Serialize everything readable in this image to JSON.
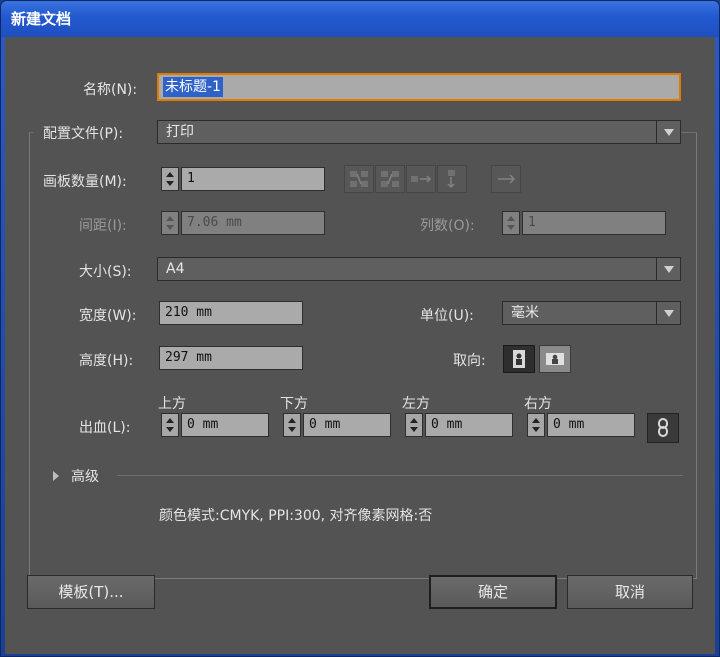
{
  "window": {
    "title": "新建文档"
  },
  "name": {
    "label": "名称(N):",
    "value": "未标题-1"
  },
  "profile": {
    "label": "配置文件(P):",
    "value": "打印"
  },
  "artboards": {
    "count_label": "画板数量(M):",
    "count_value": "1",
    "spacing_label": "间距(I):",
    "spacing_value": "7.06 mm",
    "columns_label": "列数(O):",
    "columns_value": "1"
  },
  "size": {
    "label": "大小(S):",
    "value": "A4"
  },
  "width": {
    "label": "宽度(W):",
    "value": "210 mm"
  },
  "units": {
    "label": "单位(U):",
    "value": "毫米"
  },
  "height": {
    "label": "高度(H):",
    "value": "297 mm"
  },
  "orientation": {
    "label": "取向:"
  },
  "bleed": {
    "label": "出血(L):",
    "top_label": "上方",
    "top_value": "0 mm",
    "bottom_label": "下方",
    "bottom_value": "0 mm",
    "left_label": "左方",
    "left_value": "0 mm",
    "right_label": "右方",
    "right_value": "0 mm"
  },
  "advanced": {
    "label": "高级"
  },
  "info": {
    "text": "颜色模式:CMYK, PPI:300, 对齐像素网格:否"
  },
  "buttons": {
    "templates": "模板(T)...",
    "ok": "确定",
    "cancel": "取消"
  },
  "colors": {
    "focus": "#e07b00",
    "selection": "#2f62c8",
    "panel": "#535353"
  }
}
